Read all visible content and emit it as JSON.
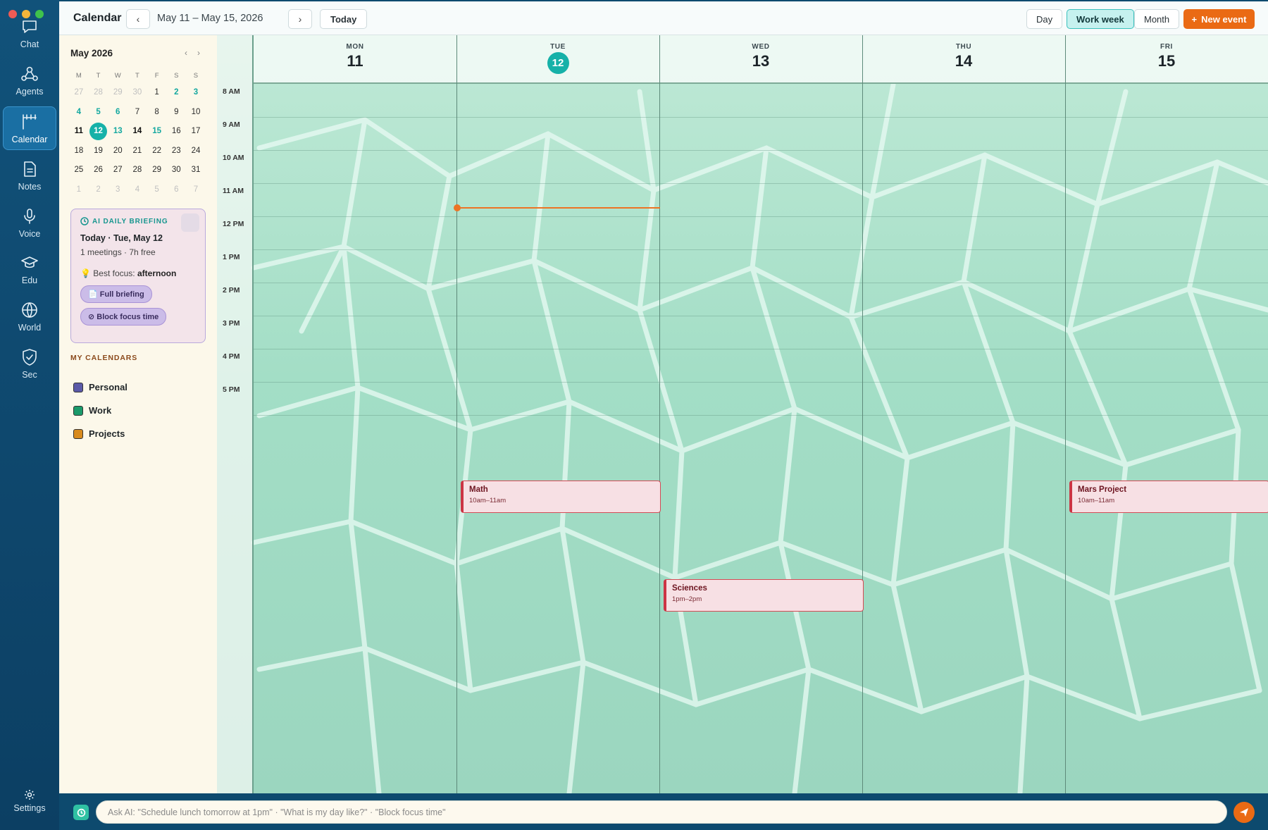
{
  "rail": {
    "items": [
      {
        "label": "Chat",
        "icon": "chat-icon"
      },
      {
        "label": "Agents",
        "icon": "agents-icon"
      },
      {
        "label": "Calendar",
        "icon": "calendar-icon",
        "active": true
      },
      {
        "label": "Notes",
        "icon": "notes-icon"
      },
      {
        "label": "Voice",
        "icon": "microphone-icon"
      },
      {
        "label": "Edu",
        "icon": "graduation-cap-icon"
      },
      {
        "label": "World",
        "icon": "globe-icon"
      },
      {
        "label": "Sec",
        "icon": "shield-icon"
      }
    ],
    "settings_label": "Settings"
  },
  "topbar": {
    "title": "Calendar",
    "prev_glyph": "‹",
    "next_glyph": "›",
    "range": "May 11 – May 15, 2026",
    "today_label": "Today",
    "views": [
      {
        "label": "Day",
        "active": false
      },
      {
        "label": "Work week",
        "active": true
      },
      {
        "label": "Month",
        "active": false
      }
    ],
    "new_event_label": "New event",
    "new_event_plus": "+"
  },
  "mini_calendar": {
    "month_label": "May 2026",
    "prev_glyph": "‹",
    "next_glyph": "›",
    "dow": [
      "M",
      "T",
      "W",
      "T",
      "F",
      "S",
      "S"
    ],
    "weeks": [
      [
        {
          "d": "27",
          "s": "muted"
        },
        {
          "d": "28",
          "s": "muted"
        },
        {
          "d": "29",
          "s": "muted"
        },
        {
          "d": "30",
          "s": "muted"
        },
        {
          "d": "1",
          "s": ""
        },
        {
          "d": "2",
          "s": "teal"
        },
        {
          "d": "3",
          "s": "teal"
        }
      ],
      [
        {
          "d": "4",
          "s": "teal"
        },
        {
          "d": "5",
          "s": "teal"
        },
        {
          "d": "6",
          "s": "teal"
        },
        {
          "d": "7",
          "s": ""
        },
        {
          "d": "8",
          "s": ""
        },
        {
          "d": "9",
          "s": ""
        },
        {
          "d": "10",
          "s": ""
        }
      ],
      [
        {
          "d": "11",
          "s": "bold"
        },
        {
          "d": "12",
          "s": "today"
        },
        {
          "d": "13",
          "s": "teal"
        },
        {
          "d": "14",
          "s": "bold"
        },
        {
          "d": "15",
          "s": "teal"
        },
        {
          "d": "16",
          "s": ""
        },
        {
          "d": "17",
          "s": ""
        }
      ],
      [
        {
          "d": "18",
          "s": ""
        },
        {
          "d": "19",
          "s": ""
        },
        {
          "d": "20",
          "s": ""
        },
        {
          "d": "21",
          "s": ""
        },
        {
          "d": "22",
          "s": ""
        },
        {
          "d": "23",
          "s": ""
        },
        {
          "d": "24",
          "s": ""
        }
      ],
      [
        {
          "d": "25",
          "s": ""
        },
        {
          "d": "26",
          "s": ""
        },
        {
          "d": "27",
          "s": ""
        },
        {
          "d": "28",
          "s": ""
        },
        {
          "d": "29",
          "s": ""
        },
        {
          "d": "30",
          "s": ""
        },
        {
          "d": "31",
          "s": ""
        }
      ],
      [
        {
          "d": "1",
          "s": "muted"
        },
        {
          "d": "2",
          "s": "muted"
        },
        {
          "d": "3",
          "s": "muted"
        },
        {
          "d": "4",
          "s": "muted"
        },
        {
          "d": "5",
          "s": "muted"
        },
        {
          "d": "6",
          "s": "muted"
        },
        {
          "d": "7",
          "s": "muted"
        }
      ]
    ]
  },
  "briefing": {
    "heading": "AI DAILY BRIEFING",
    "date": "Today · Tue, May 12",
    "meta": "1 meetings · 7h free",
    "focus_prefix": "💡 Best focus: ",
    "focus_value": "afternoon",
    "full_label": "📄 Full briefing",
    "block_label": "⊘ Block focus time"
  },
  "my_calendars": {
    "title": "MY CALENDARS",
    "items": [
      {
        "label": "Personal",
        "color": "#5b5aa8"
      },
      {
        "label": "Work",
        "color": "#1a9a6a"
      },
      {
        "label": "Projects",
        "color": "#d88a1c"
      }
    ]
  },
  "week": {
    "days": [
      {
        "dow": "MON",
        "num": "11",
        "today": false
      },
      {
        "dow": "TUE",
        "num": "12",
        "today": true
      },
      {
        "dow": "WED",
        "num": "13",
        "today": false
      },
      {
        "dow": "THU",
        "num": "14",
        "today": false
      },
      {
        "dow": "FRI",
        "num": "15",
        "today": false
      }
    ],
    "hours": [
      "8 AM",
      "9 AM",
      "10 AM",
      "11 AM",
      "12 PM",
      "1 PM",
      "2 PM",
      "3 PM",
      "4 PM",
      "5 PM"
    ],
    "events": [
      {
        "title": "Math",
        "time": "10am–11am",
        "day_index": 1
      },
      {
        "title": "Sciences",
        "time": "1pm–2pm",
        "day_index": 2
      },
      {
        "title": "Mars Project",
        "time": "10am–11am",
        "day_index": 4
      }
    ]
  },
  "ai_bar": {
    "placeholder": "Ask AI: \"Schedule lunch tomorrow at 1pm\" · \"What is my day like?\" · \"Block focus time\""
  },
  "colors": {
    "accent": "#16b1a8",
    "brand_orange": "#ea6a14",
    "rail_bg": "#0d4a6e",
    "event_border": "#cc3444"
  }
}
